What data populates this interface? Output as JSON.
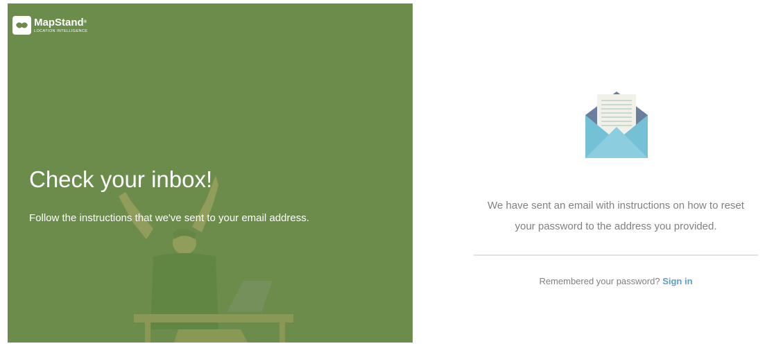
{
  "brand": {
    "name": "MapStand",
    "trademark": "®",
    "tagline": "LOCATION INTELLIGENCE",
    "logo_icon": "mapstand-logo-icon"
  },
  "left_panel": {
    "title": "Check your inbox!",
    "subtitle": "Follow the instructions that we've sent to your email address.",
    "background_color": "#6b8c4b"
  },
  "right_panel": {
    "icon": "open-envelope-icon",
    "message_line1": "We have sent an email with instructions on how to reset",
    "message_line2": "your password to the address you provided.",
    "remember_text": "Remembered your password?",
    "signin_label": "Sign in",
    "link_color": "#5a9fc4"
  }
}
